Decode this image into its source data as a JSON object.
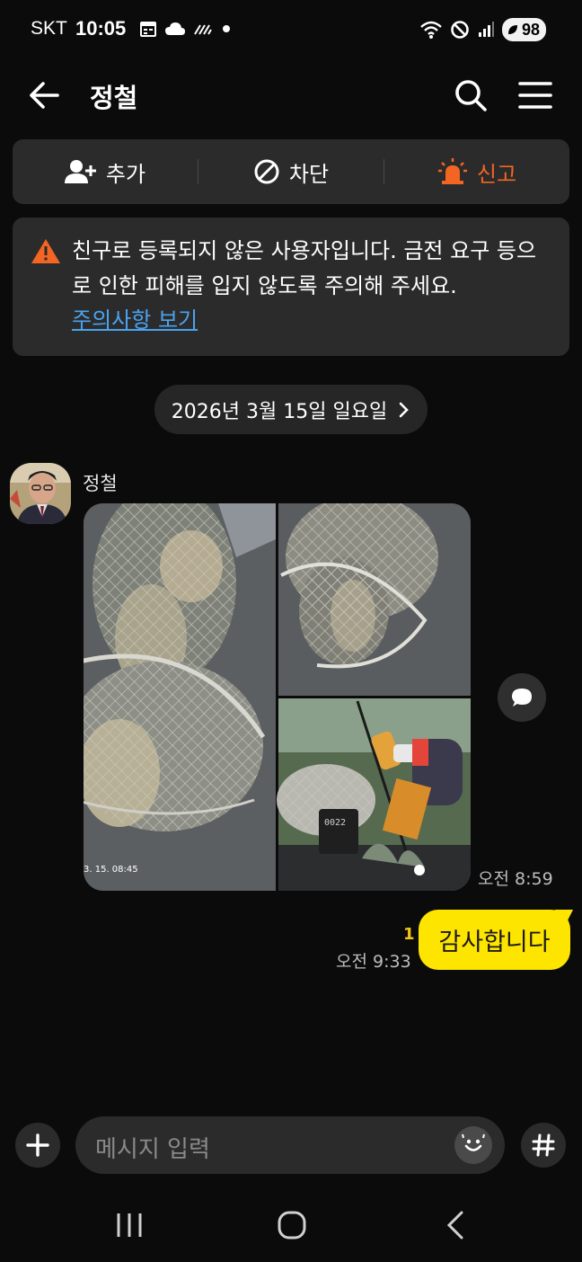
{
  "status_bar": {
    "carrier": "SKT",
    "time": "10:05",
    "battery": "98"
  },
  "header": {
    "title": "정철"
  },
  "actions": {
    "add_label": "추가",
    "block_label": "차단",
    "report_label": "신고"
  },
  "warning": {
    "text": "친구로 등록되지 않은 사용자입니다. 금전 요구 등으로 인한 피해를 입지 않도록 주의해 주세요.",
    "link": "주의사항 보기"
  },
  "date_chip": "2026년 3월 15일 일요일",
  "messages": {
    "incoming": {
      "sender": "정철",
      "time": "오전 8:59",
      "photo_stamp": "3. 15. 08:45",
      "counter_reading": "0022"
    },
    "outgoing": {
      "text": "감사합니다",
      "time": "오전 9:33",
      "unread": "1"
    }
  },
  "input": {
    "placeholder": "메시지 입력"
  },
  "colors": {
    "background": "#0b0b0b",
    "panel": "#2b2b2b",
    "report": "#f26522",
    "link": "#4aa3f0",
    "bubble": "#fee500"
  }
}
